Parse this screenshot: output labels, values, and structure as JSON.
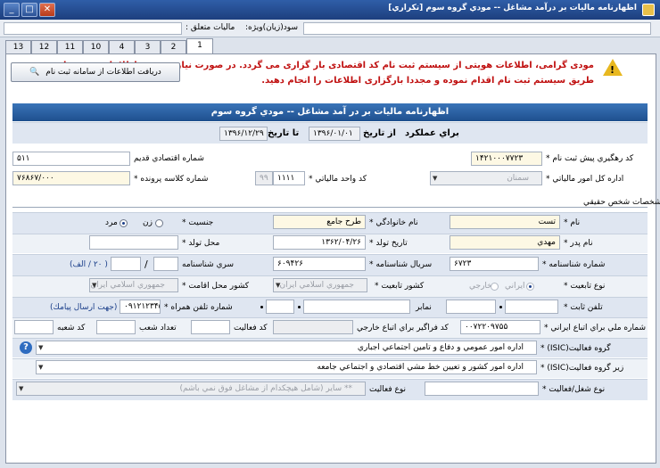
{
  "window": {
    "title": "اظهارنامه ماليات بر درآمد مشاغل -- مودي گروه سوم [تكراري]"
  },
  "menu": {
    "sood_label": "سود(زيان)ويژه:",
    "maliat_label": "ماليات متعلق :"
  },
  "tabs": [
    "1",
    "2",
    "3",
    "4",
    "10",
    "11",
    "12",
    "13"
  ],
  "notice": {
    "line1": "مودی گرامی، اطلاعات هویتی از سیستم ثبت نام کد اقتصادی بار گزاری می گردد. در صورت نیاز به تغییر اطلاعات هویتی از",
    "line2": "طریق سیستم ثبت نام اقدام نموده و مجددا بارگزاری اطلاعات را انجام دهید."
  },
  "fetch_button": "دريافت اطلاعات از سامانه ثبت نام",
  "form_header": "اظهارنامه ماليات بر در آمد مشاغل -- مودي گروه سوم",
  "period": {
    "label": "براي عملكرد",
    "from_label": "از تاريخ",
    "from": "۱۳۹۶/۰۱/۰۱",
    "to_label": "تا تاريخ",
    "to": "۱۳۹۶/۱۲/۲۹"
  },
  "registration": {
    "label": "كد رهگيري پيش ثبت نام *",
    "value": "۱۴۲۱۰۰۰۷۷۲۳"
  },
  "old_econ": {
    "label": "شماره اقتصادي قديم",
    "value": "۵۱۱"
  },
  "tax_office": {
    "label": "اداره كل امور مالياتي *",
    "value": "سمنان"
  },
  "tax_unit": {
    "label": "كد واحد مالياتي *",
    "code": "۱۱۱۱",
    "sub": "۹۹"
  },
  "file_class": {
    "label": "شماره كلاسه پرونده *",
    "value": "۷۶۸۶۷/۰۰۰"
  },
  "section_title": "مشخصات شخص حقيقي",
  "person": {
    "name_label": "نام *",
    "name": "تست",
    "family_label": "نام خانوادگي *",
    "family": "طرح جامع",
    "gender_label": "جنسيت *",
    "gender_female": "زن",
    "gender_male": "مرد",
    "father_label": "نام پدر *",
    "father": "مهدي",
    "birth_date_label": "تاريخ تولد *",
    "birth_date": "۱۳۶۲/۰۴/۲۶",
    "birth_place_label": "محل تولد *",
    "birth_place": "",
    "id_no_label": "شماره شناسنامه *",
    "id_no": "۶۷۲۳",
    "id_serial_label": "سريال شناسنامه *",
    "id_serial": "۶۰۹۴۲۶",
    "id_series_label": "سري شناسنامه",
    "id_series_hint": "( ۲۰ / الف)",
    "nationality_type_label": "نوع تابعيت *",
    "iranian": "ايراني",
    "foreign": "خارجي",
    "nationality_country_label": "كشور تابعيت *",
    "nationality_country": "جمهوري اسلامي ايران",
    "residence_label": "كشور محل اقامت *",
    "residence": "جمهوري اسلامي ايران",
    "phone_label": "تلفن ثابت *",
    "fax_label": "نمابر",
    "mobile_label": "شماره تلفن همراه *",
    "mobile": "۰۹۱۲۱۲۳۴۵۶۷",
    "mobile_hint": "(جهت ارسال پيامك)",
    "national_id_label": "شماره ملي براي اتباع ايراني *",
    "national_id": "۰۰۷۲۲۰۹۷۵۵",
    "foreign_code_label": "كد فراگير براي اتباع خارجي",
    "activity_code_label": "كد فعاليت",
    "branch_count_label": "تعداد شعب",
    "branch_code_label": "كد شعبه",
    "isic_group_label": "گروه فعاليت(ISIC) *",
    "isic_group": "اداره امور عمومي و دفاع و تامين اجتماعي اجباري",
    "isic_sub_label": "زير گروه فعاليت(ISIC) *",
    "isic_sub": "اداره امور كشور و تعيين خط مشي اقتصادي و اجتماعي جامعه",
    "activity_type_label": "نوع فعاليت",
    "activity_type": "** ساير (شامل هيچكدام از مشاغل فوق نمي باشم)",
    "job_type_label": "نوع شغل/فعاليت *",
    "job_type": ""
  },
  "colors": {
    "header": "#1e4f8e",
    "notice": "#c01010",
    "band": "#dfe6f1"
  }
}
